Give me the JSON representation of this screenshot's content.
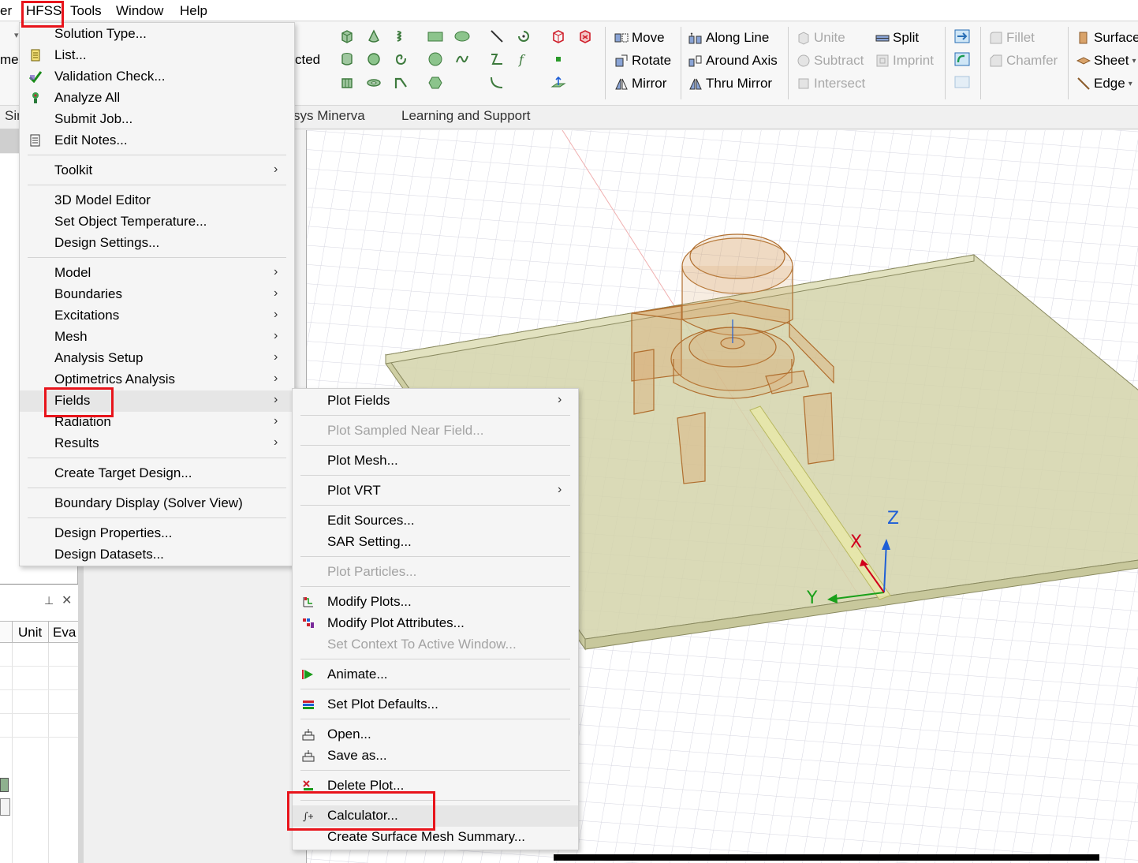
{
  "menubar": {
    "items": [
      "er",
      "HFSS",
      "Tools",
      "Window",
      "Help"
    ]
  },
  "ribbon": {
    "partial_labels": {
      "left": "me",
      "mid": "cted"
    },
    "transform": {
      "move": "Move",
      "rotate": "Rotate",
      "mirror": "Mirror"
    },
    "duplicate": {
      "along_line": "Along Line",
      "around_axis": "Around Axis",
      "thru_mirror": "Thru Mirror"
    },
    "boolean": {
      "unite": "Unite",
      "subtract": "Subtract",
      "intersect": "Intersect",
      "split": "Split",
      "imprint": "Imprint"
    },
    "edit": {
      "fillet": "Fillet",
      "chamfer": "Chamfer"
    },
    "select": {
      "surface": "Surface",
      "sheet": "Sheet",
      "edge": "Edge"
    }
  },
  "tabs": {
    "sim_partial": "Sir",
    "minerva_partial": "sys Minerva",
    "learning": "Learning and Support"
  },
  "props_panel": {
    "col_unit": "Unit",
    "col_eval": "Eva"
  },
  "hfss_menu": {
    "solution_type": "Solution Type...",
    "list": "List...",
    "validation_check": "Validation Check...",
    "analyze_all": "Analyze All",
    "submit_job": "Submit Job...",
    "edit_notes": "Edit Notes...",
    "toolkit": "Toolkit",
    "model_editor": "3D Model Editor",
    "set_object_temperature": "Set Object Temperature...",
    "design_settings": "Design Settings...",
    "model": "Model",
    "boundaries": "Boundaries",
    "excitations": "Excitations",
    "mesh": "Mesh",
    "analysis_setup": "Analysis Setup",
    "optimetrics": "Optimetrics Analysis",
    "fields": "Fields",
    "radiation": "Radiation",
    "results": "Results",
    "create_target_design": "Create Target Design...",
    "boundary_display": "Boundary Display (Solver View)",
    "design_properties": "Design Properties...",
    "design_datasets": "Design Datasets..."
  },
  "fields_menu": {
    "plot_fields": "Plot Fields",
    "plot_sampled": "Plot Sampled Near Field...",
    "plot_mesh": "Plot Mesh...",
    "plot_vrt": "Plot VRT",
    "edit_sources": "Edit Sources...",
    "sar_setting": "SAR Setting...",
    "plot_particles": "Plot Particles...",
    "modify_plots": "Modify Plots...",
    "modify_plot_attributes": "Modify Plot Attributes...",
    "set_context": "Set Context To Active Window...",
    "animate": "Animate...",
    "set_plot_defaults": "Set Plot Defaults...",
    "open": "Open...",
    "save_as": "Save as...",
    "delete_plot": "Delete Plot...",
    "calculator": "Calculator...",
    "surface_mesh_summary": "Create Surface Mesh Summary..."
  },
  "axes": {
    "x": "X",
    "y": "Y",
    "z": "Z"
  },
  "colors": {
    "highlight_box": "#e8141b",
    "model_body": "#d9a36a",
    "substrate": "#c8c89a",
    "axis_x": "#d0001b",
    "axis_y": "#1aa01a",
    "axis_z": "#1f5fd6"
  }
}
